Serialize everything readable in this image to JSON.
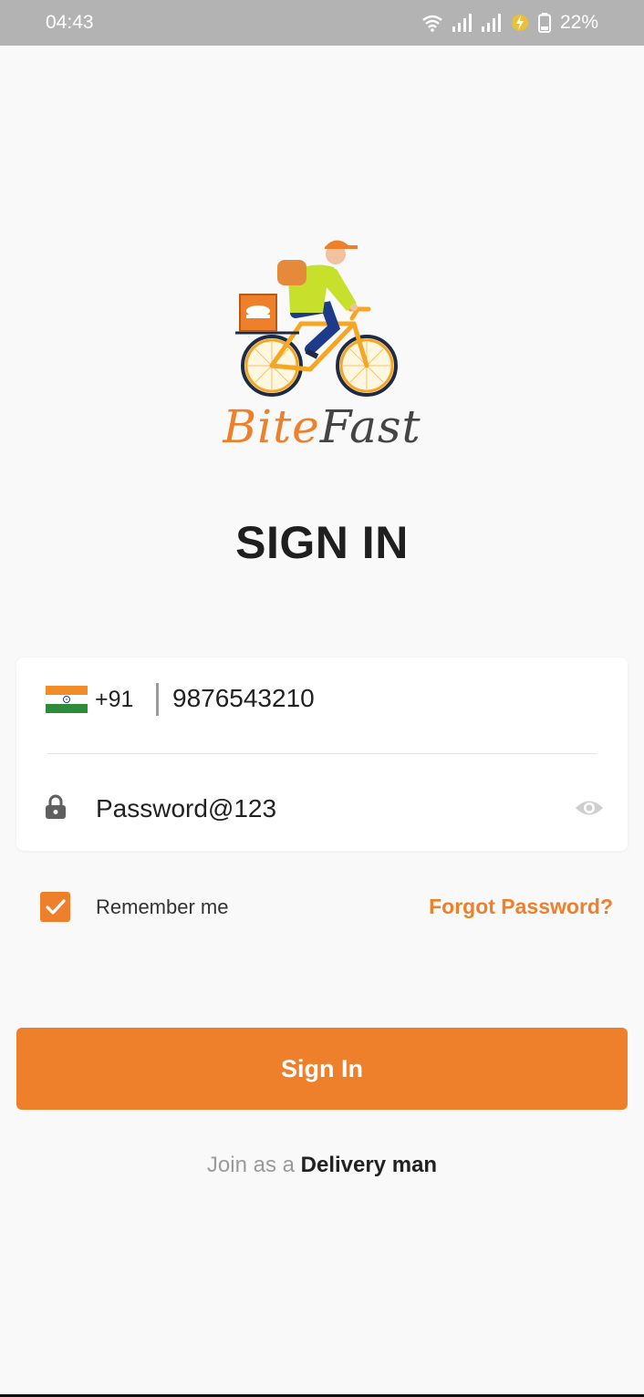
{
  "status_bar": {
    "time": "04:43",
    "battery": "22%",
    "icons": [
      "wifi-icon",
      "signal-icon",
      "signal-icon",
      "charging-icon",
      "battery-icon"
    ]
  },
  "brand": {
    "part1": "Bite",
    "part2": "Fast",
    "logo_icon": "delivery-bicycle-icon",
    "accent": "#ee7f2b"
  },
  "screen": {
    "title": "SIGN IN"
  },
  "form": {
    "country_code": "+91",
    "flag_icon": "india-flag-icon",
    "phone_value": "9876543210",
    "password_value": "Password@123",
    "password_icon": "lock-icon",
    "visibility_icon": "eye-icon"
  },
  "remember": {
    "label": "Remember me",
    "checked": true
  },
  "forgot_label": "Forgot Password?",
  "signin_label": "Sign In",
  "join": {
    "prefix": "Join as a ",
    "role": "Delivery man"
  },
  "colors": {
    "primary": "#ee7f2b",
    "background": "#f9f9f9",
    "status_bar": "#b3b3b3"
  }
}
